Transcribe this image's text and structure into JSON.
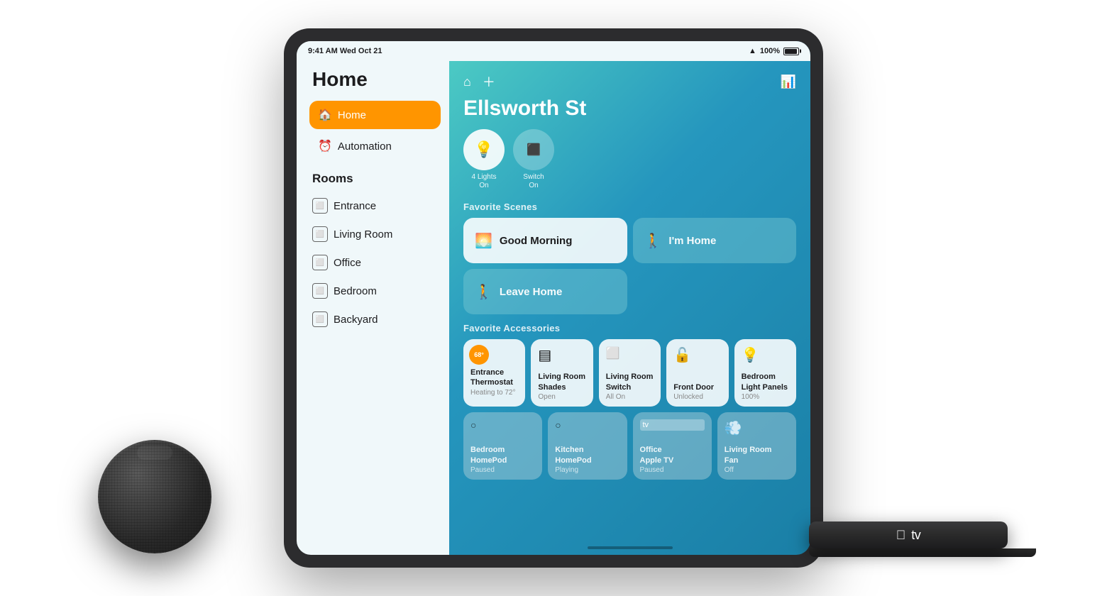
{
  "statusBar": {
    "time": "9:41 AM",
    "date": "Wed Oct 21",
    "battery": "100%"
  },
  "sidebar": {
    "title": "Home",
    "navItems": [
      {
        "id": "home",
        "label": "Home",
        "icon": "🏠",
        "active": true
      },
      {
        "id": "automation",
        "label": "Automation",
        "icon": "⏰",
        "active": false
      }
    ],
    "roomsTitle": "Rooms",
    "rooms": [
      {
        "id": "entrance",
        "label": "Entrance"
      },
      {
        "id": "living-room",
        "label": "Living Room"
      },
      {
        "id": "office",
        "label": "Office"
      },
      {
        "id": "bedroom",
        "label": "Bedroom"
      },
      {
        "id": "backyard",
        "label": "Backyard"
      }
    ]
  },
  "main": {
    "homeTitle": "Ellsworth St",
    "quickAccess": [
      {
        "id": "lights",
        "label": "4 Lights\nOn",
        "icon": "💡",
        "active": true
      },
      {
        "id": "switch",
        "label": "Switch\nOn",
        "icon": "⬜",
        "active": false
      }
    ],
    "favoriteScenesTitle": "Favorite Scenes",
    "scenes": [
      {
        "id": "good-morning",
        "label": "Good Morning",
        "icon": "🌅",
        "style": "light"
      },
      {
        "id": "im-home",
        "label": "I'm Home",
        "icon": "🚶",
        "style": "teal"
      },
      {
        "id": "leave-home",
        "label": "Leave Home",
        "icon": "🚶",
        "style": "teal"
      }
    ],
    "favoriteAccessoriesTitle": "Favorite Accessories",
    "accessories": [
      {
        "id": "entrance-thermostat",
        "name": "Entrance Thermostat",
        "status": "Heating to 72°",
        "icon": "🌡️",
        "style": "light",
        "temp": "68°"
      },
      {
        "id": "living-room-shades",
        "name": "Living Room Shades",
        "status": "Open",
        "icon": "▤",
        "style": "light"
      },
      {
        "id": "living-room-switch",
        "name": "Living Room Switch",
        "status": "All On",
        "icon": "⬜",
        "style": "light"
      },
      {
        "id": "front-door",
        "name": "Front Door",
        "status": "Unlocked",
        "icon": "🔓",
        "style": "light"
      },
      {
        "id": "bedroom-light-panels",
        "name": "Bedroom Light Panels",
        "status": "100%",
        "icon": "💡",
        "style": "light"
      }
    ],
    "accessories2": [
      {
        "id": "bedroom-homepod",
        "name": "Bedroom HomePod",
        "status": "Paused",
        "icon": "⬜",
        "style": "muted"
      },
      {
        "id": "kitchen-homepod",
        "name": "Kitchen HomePod",
        "status": "Playing",
        "icon": "⬜",
        "style": "muted"
      },
      {
        "id": "office-apple-tv",
        "name": "Office Apple TV",
        "status": "Paused",
        "icon": "📺",
        "style": "muted"
      },
      {
        "id": "living-room-fan",
        "name": "Living Room Fan",
        "status": "Off",
        "icon": "💨",
        "style": "muted"
      }
    ]
  }
}
